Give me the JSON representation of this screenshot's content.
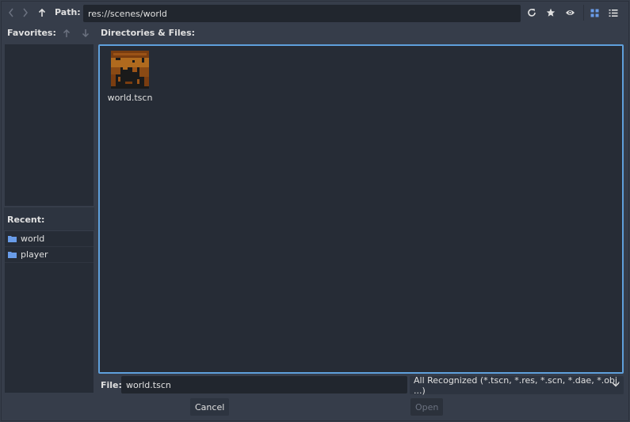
{
  "topbar": {
    "path_label": "Path:",
    "path_value": "res://scenes/world",
    "icons": [
      "back-arrow-icon",
      "forward-arrow-icon",
      "up-arrow-icon",
      "refresh-icon",
      "favorite-star-icon",
      "toggle-hidden-eye-icon",
      "thumbnail-view-icon",
      "list-view-icon"
    ]
  },
  "favorites": {
    "label": "Favorites:",
    "items": []
  },
  "recent": {
    "label": "Recent:",
    "items": [
      {
        "label": "world"
      },
      {
        "label": "player"
      }
    ]
  },
  "files": {
    "label": "Directories & Files:",
    "items": [
      {
        "name": "world.tscn",
        "icon": "scene-thumbnail"
      }
    ]
  },
  "bottom": {
    "file_label": "File:",
    "file_value": "world.tscn",
    "filter_selected": "All Recognized (*.tscn, *.res, *.scn, *.dae, *.obj, ...)",
    "cancel_label": "Cancel",
    "open_label": "Open"
  },
  "colors": {
    "background": "#363d4a",
    "panel": "#262c36",
    "accent": "#5fa0dc",
    "folder": "#699ce8"
  }
}
